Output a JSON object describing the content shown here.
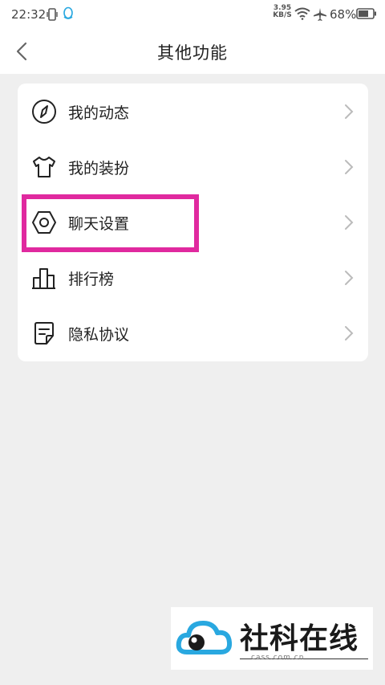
{
  "status_bar": {
    "time": "22:32",
    "net_speed": "3.95 KB/S",
    "battery_percent": "68%",
    "icons": [
      "vibrate-icon",
      "qq-icon",
      "wifi-icon",
      "airplane-icon",
      "battery-icon"
    ]
  },
  "header": {
    "title": "其他功能",
    "back_icon": "chevron-left-icon"
  },
  "menu": {
    "items": [
      {
        "label": "我的动态",
        "icon": "compass-icon"
      },
      {
        "label": "我的装扮",
        "icon": "tshirt-icon"
      },
      {
        "label": "聊天设置",
        "icon": "hex-nut-icon"
      },
      {
        "label": "排行榜",
        "icon": "ranking-bars-icon"
      },
      {
        "label": "隐私协议",
        "icon": "document-icon"
      }
    ]
  },
  "highlight": {
    "color": "#e0299f"
  },
  "watermark": {
    "brand": "社科在线",
    "domain": "cass.com.cn"
  },
  "colors": {
    "background": "#efefef",
    "card": "#ffffff",
    "text": "#222222",
    "chevron": "#bbbbbb",
    "accent_blue": "#29a8e0"
  }
}
